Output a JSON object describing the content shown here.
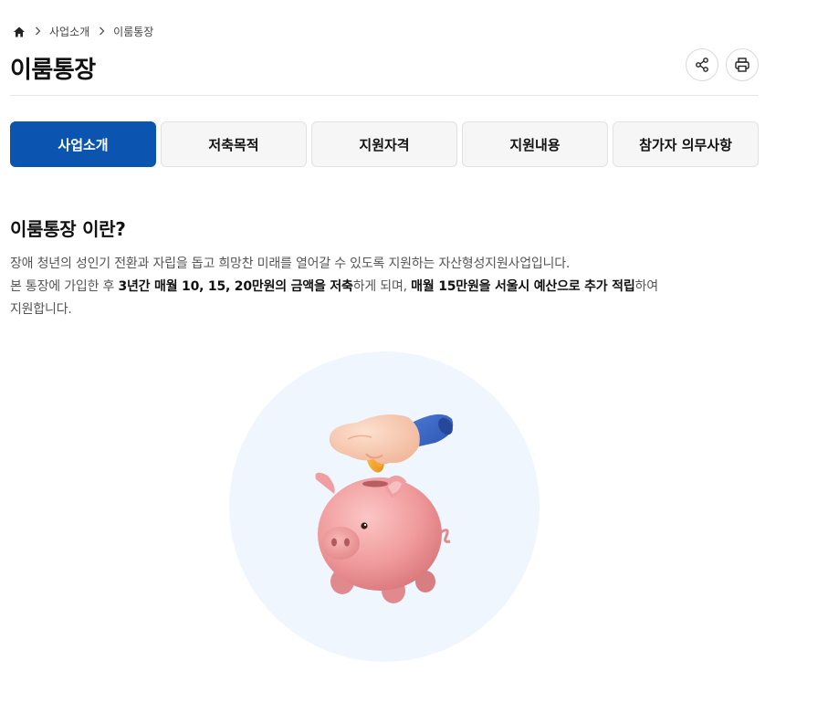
{
  "breadcrumb": {
    "items": [
      "사업소개",
      "이룸통장"
    ]
  },
  "page": {
    "title": "이룸통장"
  },
  "toolbar": {
    "share_icon": "share-icon",
    "print_icon": "print-icon"
  },
  "tabs": [
    {
      "label": "사업소개",
      "active": true
    },
    {
      "label": "저축목적",
      "active": false
    },
    {
      "label": "지원자격",
      "active": false
    },
    {
      "label": "지원내용",
      "active": false
    },
    {
      "label": "참가자 의무사항",
      "active": false
    }
  ],
  "section": {
    "title": "이룸통장 이란?",
    "line1": "장애 청년의 성인기 전환과 자립을 돕고 희망찬 미래를 열어갈 수 있도록 지원하는 자산형성지원사업입니다.",
    "line2_a": "본 통장에 가입한 후 ",
    "line2_b": "3년간 매월 10, 15, 20만원의 금액을 저축",
    "line2_c": "하게 되며, ",
    "line2_d": "매월 15만원을 서울시 예산으로 추가 적립",
    "line2_e": "하여",
    "line3": "지원합니다."
  },
  "illustration": {
    "icon": "piggy-bank-coin-illustration"
  },
  "colors": {
    "accent": "#0b55b1",
    "tab_bg": "#f6f6f6",
    "illustration_bg": "#eff6fd"
  }
}
